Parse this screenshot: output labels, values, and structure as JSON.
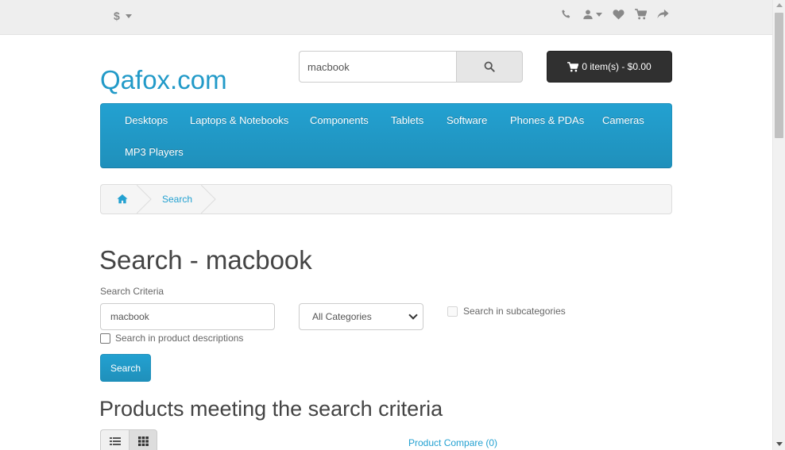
{
  "top_bar": {
    "currency_symbol": "$",
    "icons": [
      "phone-icon",
      "user-icon",
      "heart-icon",
      "shopping-cart-icon",
      "share-icon"
    ]
  },
  "header": {
    "logo_text": "Qafox.com",
    "search_value": "macbook",
    "cart_label": "0 item(s) - $0.00"
  },
  "menu": {
    "items": [
      "Desktops",
      "Laptops & Notebooks",
      "Components",
      "Tablets",
      "Software",
      "Phones & PDAs",
      "Cameras",
      "MP3 Players"
    ]
  },
  "breadcrumb": {
    "items": [
      "Search"
    ]
  },
  "page": {
    "title": "Search - macbook",
    "criteria_label": "Search Criteria",
    "criteria_value": "macbook",
    "category_selected": "All Categories",
    "subcategories_label": "Search in subcategories",
    "descriptions_label": "Search in product descriptions",
    "search_button": "Search",
    "results_heading": "Products meeting the search criteria",
    "compare_link": "Product Compare (0)"
  },
  "colors": {
    "accent": "#229ac8",
    "menu_bg": "#229ac8",
    "cart_bg": "#303030"
  }
}
